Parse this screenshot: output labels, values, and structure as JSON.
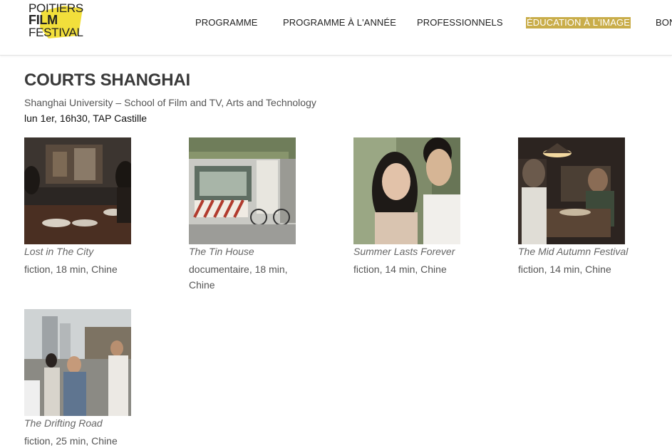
{
  "header": {
    "logo": {
      "line1": "POITIERS",
      "line2": "FILM",
      "line3": "FESTIVAL",
      "accent_color": "#f2df3b"
    },
    "nav": [
      {
        "label": "PROGRAMME",
        "active": false
      },
      {
        "label": "PROGRAMME À L'ANNÉE",
        "active": false
      },
      {
        "label": "PROFESSIONNELS",
        "active": false
      },
      {
        "label": "ÉDUCATION À L'IMAGE",
        "active": true
      },
      {
        "label": "BON",
        "active": false
      }
    ],
    "active_color": "#c9ad4a"
  },
  "main": {
    "title": "COURTS SHANGHAI",
    "subtitle": "Shanghai University  –  School of Film and TV, Arts and Technology",
    "schedule": "lun 1er, 16h30, TAP Castille"
  },
  "films": [
    {
      "title": "Lost in The City",
      "meta": "fiction, 18 min, Chine",
      "thumb": "restaurant-interior-scene"
    },
    {
      "title": "The Tin House",
      "meta": "documentaire, 18 min, Chine",
      "thumb": "street-shack-with-bicycle"
    },
    {
      "title": "Summer Lasts Forever",
      "meta": "fiction, 14 min, Chine",
      "thumb": "young-couple-portrait"
    },
    {
      "title": "The Mid Autumn Festival",
      "meta": "fiction, 14 min, Chine",
      "thumb": "dim-room-dinner"
    },
    {
      "title": "The Drifting Road",
      "meta": "fiction, 25 min, Chine",
      "thumb": "men-on-city-street"
    }
  ]
}
